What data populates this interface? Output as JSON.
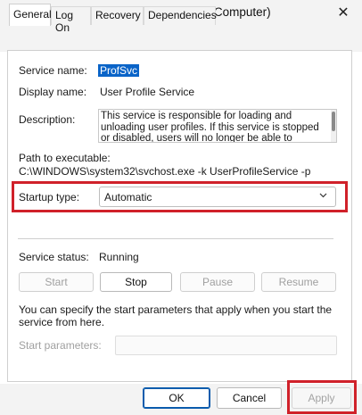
{
  "window": {
    "title": "User Profile Service Properties (Local Computer)",
    "close_glyph": "✕"
  },
  "tabs": [
    {
      "label": "General"
    },
    {
      "label": "Log On"
    },
    {
      "label": "Recovery"
    },
    {
      "label": "Dependencies"
    }
  ],
  "general": {
    "service_name_label": "Service name:",
    "service_name_value": "ProfSvc",
    "display_name_label": "Display name:",
    "display_name_value": "User Profile Service",
    "description_label": "Description:",
    "description_text": "This service is responsible for loading and unloading user profiles. If this service is stopped or disabled, users will no longer be able to successfully sign in or",
    "path_label": "Path to executable:",
    "path_value": "C:\\WINDOWS\\system32\\svchost.exe -k UserProfileService -p",
    "startup_type_label": "Startup type:",
    "startup_type_value": "Automatic",
    "service_status_label": "Service status:",
    "service_status_value": "Running",
    "buttons": {
      "start": "Start",
      "stop": "Stop",
      "pause": "Pause",
      "resume": "Resume"
    },
    "start_params_note": "You can specify the start parameters that apply when you start the service from here.",
    "start_params_label": "Start parameters:",
    "start_params_value": ""
  },
  "dialog_buttons": {
    "ok": "OK",
    "cancel": "Cancel",
    "apply": "Apply"
  },
  "colors": {
    "highlight": "#d0212a",
    "selection": "#0a64c8",
    "primary_border": "#0b5cad"
  },
  "icons": {
    "close": "close-icon",
    "dropdown": "chevron-down-icon"
  }
}
